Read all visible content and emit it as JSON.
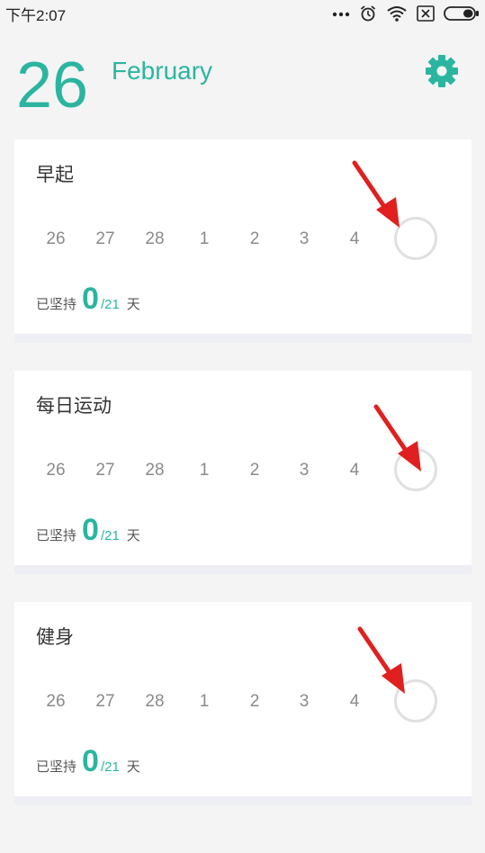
{
  "status_bar": {
    "time": "下午2:07",
    "icons": [
      "more-dots-icon",
      "alarm-icon",
      "wifi-icon",
      "sim-off-icon",
      "battery-icon"
    ]
  },
  "header": {
    "day": "26",
    "month": "February",
    "settings_icon": "gear-icon"
  },
  "colors": {
    "accent": "#2bb5a0",
    "arrow": "#e0201f",
    "circle": "#e0e0e0"
  },
  "habits": [
    {
      "title": "早起",
      "days": [
        "26",
        "27",
        "28",
        "1",
        "2",
        "3",
        "4"
      ],
      "progress_prefix": "已坚持",
      "progress_count": "0",
      "progress_total": "/21",
      "progress_unit": "天"
    },
    {
      "title": "每日运动",
      "days": [
        "26",
        "27",
        "28",
        "1",
        "2",
        "3",
        "4"
      ],
      "progress_prefix": "已坚持",
      "progress_count": "0",
      "progress_total": "/21",
      "progress_unit": "天"
    },
    {
      "title": "健身",
      "days": [
        "26",
        "27",
        "28",
        "1",
        "2",
        "3",
        "4"
      ],
      "progress_prefix": "已坚持",
      "progress_count": "0",
      "progress_total": "/21",
      "progress_unit": "天"
    }
  ]
}
